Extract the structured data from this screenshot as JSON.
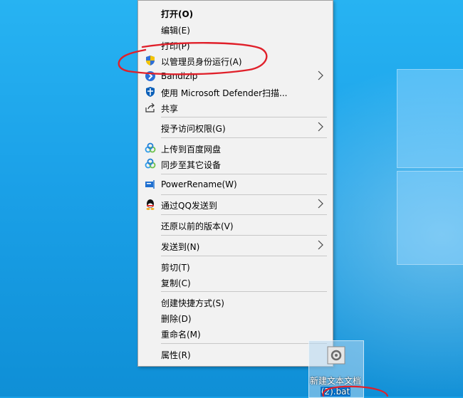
{
  "context_menu": {
    "items": [
      {
        "id": "open",
        "label": "打开(O)",
        "bold": true
      },
      {
        "id": "edit",
        "label": "编辑(E)"
      },
      {
        "id": "print",
        "label": "打印(P)"
      },
      {
        "id": "run-as-admin",
        "label": "以管理员身份运行(A)",
        "icon": "uac-shield-icon"
      },
      {
        "id": "bandizip",
        "label": "Bandizip",
        "icon": "bandizip-icon",
        "submenu": true
      },
      {
        "id": "defender",
        "label": "使用 Microsoft Defender扫描...",
        "icon": "defender-icon"
      },
      {
        "id": "share",
        "label": "共享",
        "icon": "share-icon"
      },
      {
        "id": "grant-access",
        "label": "授予访问权限(G)",
        "submenu": true
      },
      {
        "id": "upload-baidu",
        "label": "上传到百度网盘",
        "icon": "baidu-netdisk-icon"
      },
      {
        "id": "sync-devices",
        "label": "同步至其它设备",
        "icon": "baidu-netdisk-icon"
      },
      {
        "id": "powerrename",
        "label": "PowerRename(W)",
        "icon": "powerrename-icon"
      },
      {
        "id": "send-qq",
        "label": "通过QQ发送到",
        "icon": "qq-icon",
        "submenu": true
      },
      {
        "id": "restore-versions",
        "label": "还原以前的版本(V)"
      },
      {
        "id": "send-to",
        "label": "发送到(N)",
        "submenu": true
      },
      {
        "id": "cut",
        "label": "剪切(T)"
      },
      {
        "id": "copy",
        "label": "复制(C)"
      },
      {
        "id": "create-shortcut",
        "label": "创建快捷方式(S)"
      },
      {
        "id": "delete",
        "label": "删除(D)"
      },
      {
        "id": "rename",
        "label": "重命名(M)"
      },
      {
        "id": "properties",
        "label": "属性(R)"
      }
    ]
  },
  "desktop_file": {
    "name_line1": "新建文本文档",
    "name_line2": "(2).bat",
    "icon": "batch-file-icon"
  },
  "colors": {
    "menu_bg": "#f2f2f2",
    "annotation_red": "#e0202a",
    "desktop_blue": "#1aa0e6",
    "selection_blue": "#0078d7"
  }
}
